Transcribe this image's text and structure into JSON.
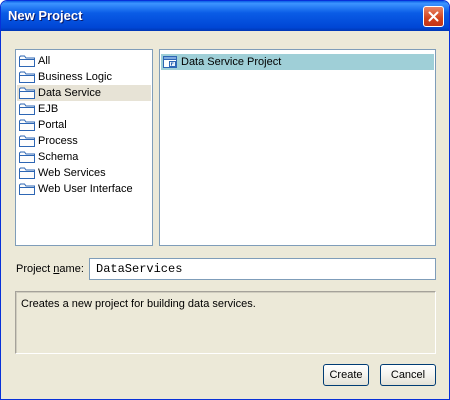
{
  "window": {
    "title": "New Project"
  },
  "categories": [
    {
      "label": "All",
      "selected": false
    },
    {
      "label": "Business Logic",
      "selected": false
    },
    {
      "label": "Data Service",
      "selected": true
    },
    {
      "label": "EJB",
      "selected": false
    },
    {
      "label": "Portal",
      "selected": false
    },
    {
      "label": "Process",
      "selected": false
    },
    {
      "label": "Schema",
      "selected": false
    },
    {
      "label": "Web Services",
      "selected": false
    },
    {
      "label": "Web User Interface",
      "selected": false
    }
  ],
  "templates": [
    {
      "label": "Data Service Project",
      "icon": "data-service-project-icon",
      "selected": true
    }
  ],
  "project_name": {
    "label_pre": "Project ",
    "label_mnemonic": "n",
    "label_post": "ame:",
    "value": "DataServices"
  },
  "description": "Creates a new project for building data services.",
  "buttons": {
    "create": "Create",
    "cancel": "Cancel"
  },
  "colors": {
    "title_bar": "#0a5ce6",
    "dialog_bg": "#ece9d8",
    "selection": "#9fcfd7",
    "close_button": "#d2421c"
  }
}
